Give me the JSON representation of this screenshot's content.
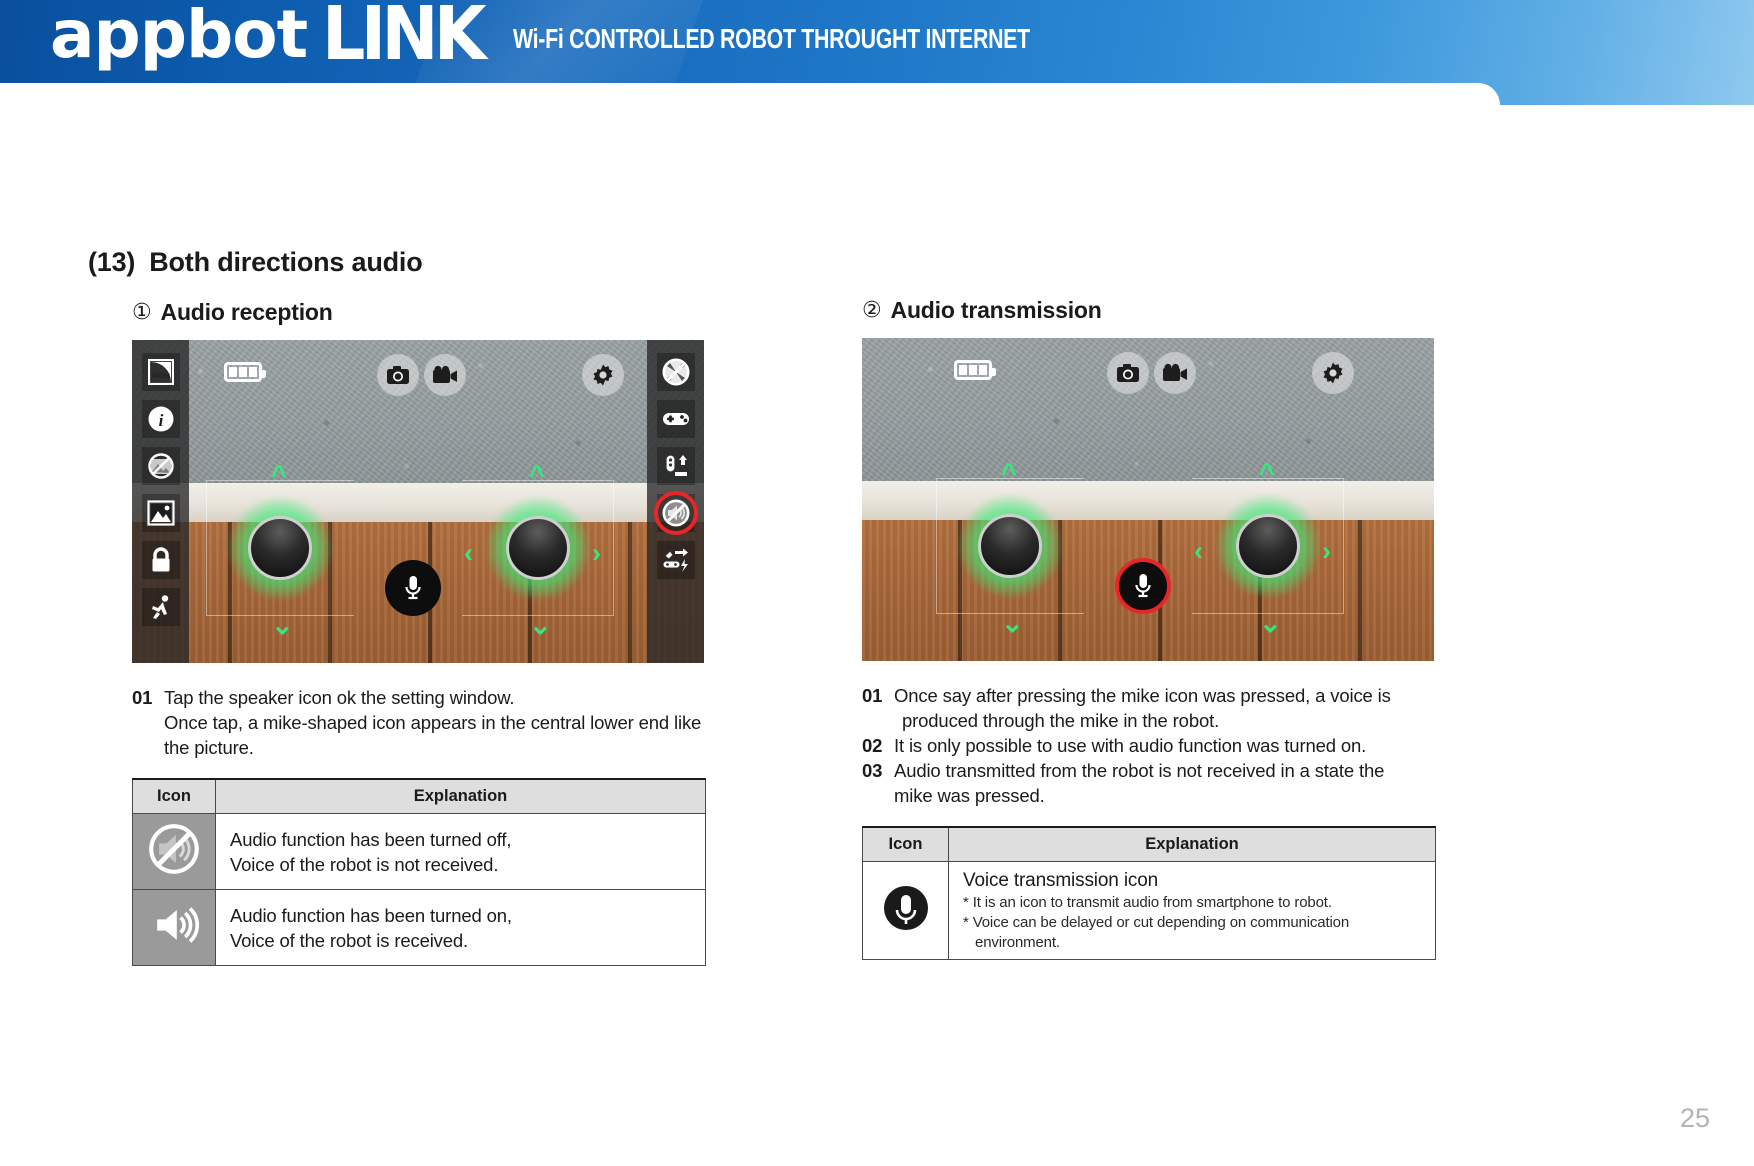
{
  "header": {
    "brand_first": "appbot",
    "brand_second": "LINK",
    "tagline": "Wi-Fi CONTROLLED ROBOT THROUGHT INTERNET",
    "bg_color": "#1668bb"
  },
  "section": {
    "number": "(13)",
    "title": "Both directions audio"
  },
  "left": {
    "marker": "①",
    "title": "Audio reception",
    "screenshot": {
      "left_toolbar_icons": [
        "quality-high-icon",
        "info-icon",
        "no-photo-icon",
        "gallery-icon",
        "lock-icon",
        "motion-detect-icon"
      ],
      "right_toolbar_icons": [
        "propeller-off-icon",
        "gamepad-icon",
        "robot-stand-up-icon",
        "speaker-muted-icon",
        "robot-charge-icon"
      ],
      "top_icons": [
        "battery-icon",
        "camera-icon",
        "video-icon",
        "gear-icon"
      ],
      "highlighted_icon": "speaker-muted-icon",
      "center_icon": "microphone-icon",
      "battery_label": "battery-icon"
    },
    "steps": [
      {
        "num": "01",
        "lines": [
          "Tap the speaker icon ok the setting window.",
          "Once tap, a mike-shaped icon appears in the central lower end like",
          "the picture."
        ]
      }
    ],
    "table": {
      "headers": [
        "Icon",
        "Explanation"
      ],
      "rows": [
        {
          "icon": "speaker-muted-icon",
          "lines": [
            "Audio function has been turned off,",
            "Voice of the robot is not received."
          ]
        },
        {
          "icon": "speaker-on-icon",
          "lines": [
            "Audio function has been turned on,",
            "Voice of the robot is received."
          ]
        }
      ]
    }
  },
  "right": {
    "marker": "②",
    "title": "Audio transmission",
    "screenshot": {
      "top_icons": [
        "battery-icon",
        "camera-icon",
        "video-icon",
        "gear-icon"
      ],
      "center_icon": "microphone-icon",
      "highlighted_icon": "microphone-icon"
    },
    "steps": [
      {
        "num": "01",
        "lines": [
          "Once say after pressing the mike icon was pressed, a voice is",
          "produced through the mike in the robot."
        ]
      },
      {
        "num": "02",
        "lines": [
          "It is only possible to use with audio function was turned on."
        ]
      },
      {
        "num": "03",
        "lines": [
          "Audio transmitted from the robot is not received in a state the",
          "mike was pressed."
        ]
      }
    ],
    "table": {
      "headers": [
        "Icon",
        "Explanation"
      ],
      "rows": [
        {
          "icon": "microphone-icon",
          "heading": "Voice transmission icon",
          "notes": [
            "* It is an icon to transmit audio from smartphone to robot.",
            "* Voice can be delayed or cut depending on communication",
            "environment."
          ]
        }
      ]
    }
  },
  "footer": {
    "page_number": "25"
  }
}
